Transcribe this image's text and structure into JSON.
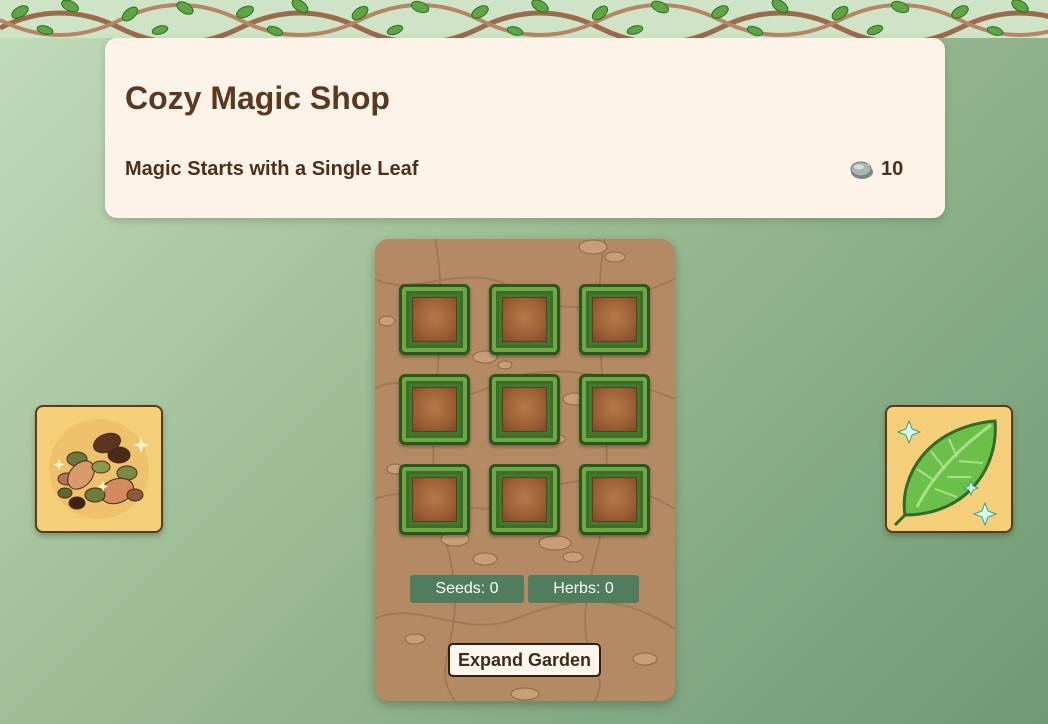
{
  "header": {
    "title": "Cozy Magic Shop",
    "subtitle": "Magic Starts with a Single Leaf",
    "currency": {
      "icon": "stone-coin-icon",
      "value": "10"
    }
  },
  "side_buttons": {
    "left": {
      "icon": "seeds-pile-icon"
    },
    "right": {
      "icon": "magic-leaf-icon"
    }
  },
  "garden": {
    "plots": [
      {
        "state": "empty"
      },
      {
        "state": "empty"
      },
      {
        "state": "empty"
      },
      {
        "state": "empty"
      },
      {
        "state": "empty"
      },
      {
        "state": "empty"
      },
      {
        "state": "empty"
      },
      {
        "state": "empty"
      },
      {
        "state": "empty"
      }
    ],
    "seeds_label": "Seeds: 0",
    "herbs_label": "Herbs: 0",
    "expand_label": "Expand Garden"
  },
  "colors": {
    "title": "#5b3820",
    "card_bg": "#fef3e8",
    "counter_bg": "#4f7d5e",
    "side_button_bg": "#f4ce78"
  }
}
